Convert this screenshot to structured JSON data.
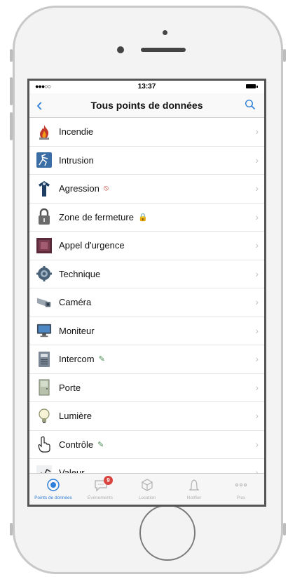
{
  "status_bar": {
    "signal": "●●●○○",
    "time": "13:37"
  },
  "nav": {
    "back_label": "‹",
    "title": "Tous points de données"
  },
  "list": [
    {
      "label": "Incendie",
      "icon": "flame-icon"
    },
    {
      "label": "Intrusion",
      "icon": "intrusion-icon"
    },
    {
      "label": "Agression",
      "icon": "agression-icon",
      "badge": "⦸",
      "badge_icon": "blocked-icon"
    },
    {
      "label": "Zone de fermeture",
      "icon": "lock-icon",
      "badge": "🔒",
      "badge_icon": "lock-small-icon"
    },
    {
      "label": "Appel d'urgence",
      "icon": "emergency-call-icon"
    },
    {
      "label": "Technique",
      "icon": "gear-icon"
    },
    {
      "label": "Caméra",
      "icon": "camera-icon"
    },
    {
      "label": "Moniteur",
      "icon": "monitor-icon"
    },
    {
      "label": "Intercom",
      "icon": "intercom-icon",
      "badge": "✎",
      "badge_icon": "edit-icon"
    },
    {
      "label": "Porte",
      "icon": "door-icon"
    },
    {
      "label": "Lumière",
      "icon": "lightbulb-icon"
    },
    {
      "label": "Contrôle",
      "icon": "hand-pointer-icon",
      "badge": "✎",
      "badge_icon": "edit-icon"
    },
    {
      "label": "Valeur",
      "icon": "chart-line-icon"
    }
  ],
  "tabs": [
    {
      "label": "Points de données",
      "icon": "target-icon",
      "active": true
    },
    {
      "label": "Événements",
      "icon": "message-icon",
      "count": "9"
    },
    {
      "label": "Location",
      "icon": "cube-icon"
    },
    {
      "label": "Notifier",
      "icon": "bell-icon"
    },
    {
      "label": "Plus",
      "icon": "more-icon"
    }
  ],
  "colors": {
    "accent": "#2d7fd9",
    "badge": "#d9453e"
  }
}
